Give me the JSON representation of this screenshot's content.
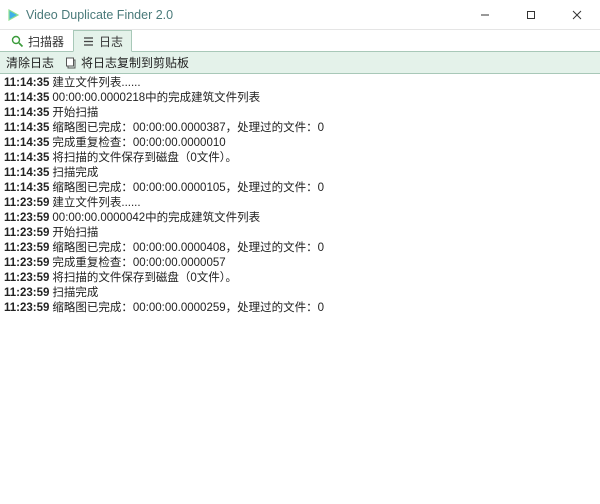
{
  "window": {
    "title": "Video Duplicate Finder 2.0"
  },
  "tabs": {
    "scanner": {
      "label": "扫描器"
    },
    "log": {
      "label": "日志"
    }
  },
  "toolbar": {
    "clear_log": "清除日志",
    "copy_log": "将日志复制到剪贴板"
  },
  "log": [
    {
      "time": "11:14:35",
      "message": "建立文件列表......"
    },
    {
      "time": "11:14:35",
      "message": "00:00:00.0000218中的完成建筑文件列表"
    },
    {
      "time": "11:14:35",
      "message": "开始扫描"
    },
    {
      "time": "11:14:35",
      "message": "缩略图已完成：00:00:00.0000387，处理过的文件：0"
    },
    {
      "time": "11:14:35",
      "message": "完成重复检查：00:00:00.0000010"
    },
    {
      "time": "11:14:35",
      "message": "将扫描的文件保存到磁盘（0文件）。"
    },
    {
      "time": "11:14:35",
      "message": "扫描完成"
    },
    {
      "time": "11:14:35",
      "message": "缩略图已完成：00:00:00.0000105，处理过的文件：0"
    },
    {
      "time": "11:23:59",
      "message": "建立文件列表......"
    },
    {
      "time": "11:23:59",
      "message": "00:00:00.0000042中的完成建筑文件列表"
    },
    {
      "time": "11:23:59",
      "message": "开始扫描"
    },
    {
      "time": "11:23:59",
      "message": "缩略图已完成：00:00:00.0000408，处理过的文件：0"
    },
    {
      "time": "11:23:59",
      "message": "完成重复检查：00:00:00.0000057"
    },
    {
      "time": "11:23:59",
      "message": "将扫描的文件保存到磁盘（0文件）。"
    },
    {
      "time": "11:23:59",
      "message": "扫描完成"
    },
    {
      "time": "11:23:59",
      "message": "缩略图已完成：00:00:00.0000259，处理过的文件：0"
    }
  ]
}
